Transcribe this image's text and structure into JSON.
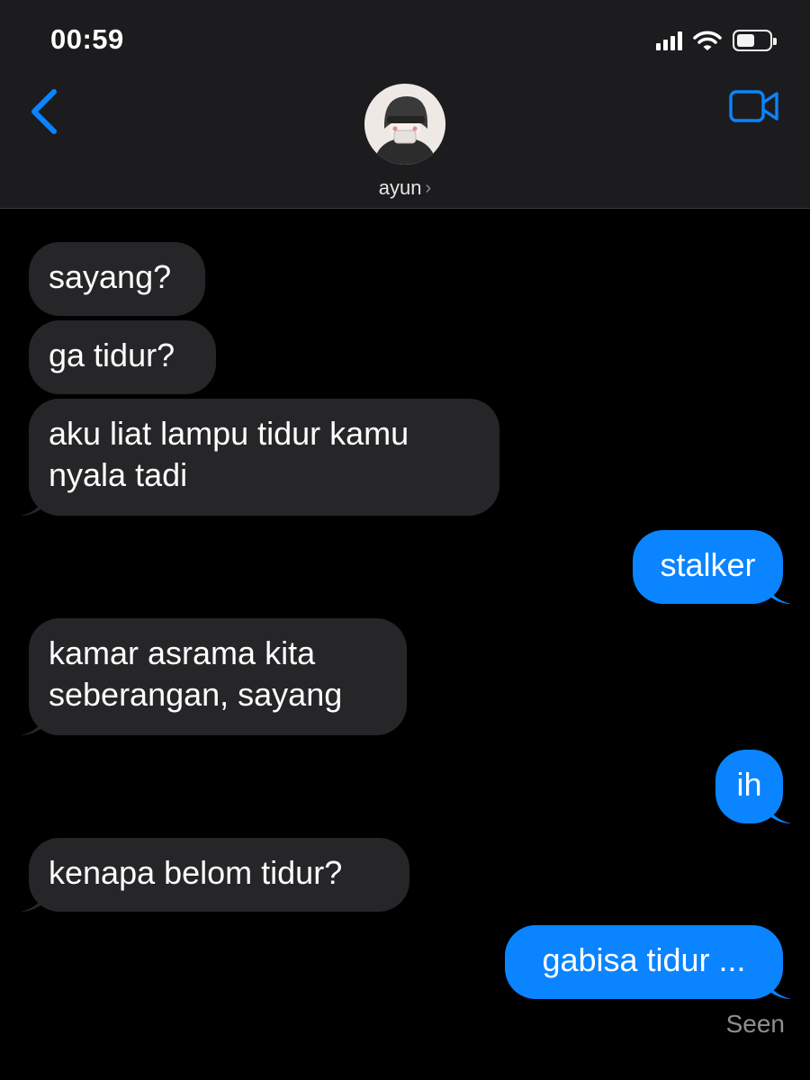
{
  "status_bar": {
    "time": "00:59",
    "icons": [
      "cellular-signal-icon",
      "wifi-icon",
      "battery-icon"
    ],
    "battery_level": 0.55
  },
  "header": {
    "contact_name": "ayun",
    "back_icon": "chevron-left-icon",
    "video_icon": "video-camera-icon",
    "accent_color": "#0a84ff"
  },
  "messages": [
    {
      "direction": "incoming",
      "text": "sayang?"
    },
    {
      "direction": "incoming",
      "text": "ga tidur?"
    },
    {
      "direction": "incoming",
      "text": "aku liat lampu tidur kamu nyala tadi"
    },
    {
      "direction": "outgoing",
      "text": "stalker"
    },
    {
      "direction": "incoming",
      "text": "kamar asrama kita seberangan, sayang"
    },
    {
      "direction": "outgoing",
      "text": "ih"
    },
    {
      "direction": "incoming",
      "text": "kenapa belom tidur?"
    },
    {
      "direction": "outgoing",
      "text": "gabisa tidur ..."
    }
  ],
  "receipt": "Seen",
  "colors": {
    "incoming_bubble": "#262628",
    "outgoing_bubble": "#0a84ff",
    "background": "#000000",
    "header_background": "#1c1c1e"
  }
}
